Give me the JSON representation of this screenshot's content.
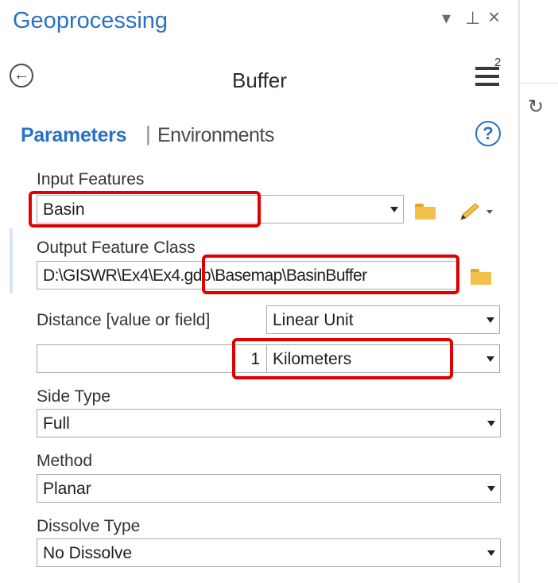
{
  "pane": {
    "title": "Geoprocessing",
    "controls": {
      "dropdown": "▾",
      "pin": "⊥",
      "close": "×"
    },
    "tool_name": "Buffer",
    "menu_badge": "2",
    "tabs": {
      "parameters": "Parameters",
      "separator": "|",
      "environments": "Environments"
    },
    "help": "?"
  },
  "params": {
    "input_features": {
      "label": "Input Features",
      "value": "Basin"
    },
    "output_feature_class": {
      "label": "Output Feature Class",
      "value": "D:\\GISWR\\Ex4\\Ex4.gdb\\Basemap\\BasinBuffer"
    },
    "distance": {
      "label": "Distance [value or field]",
      "type_value": "Linear Unit",
      "number": "1",
      "unit": "Kilometers"
    },
    "side_type": {
      "label": "Side Type",
      "value": "Full"
    },
    "method": {
      "label": "Method",
      "value": "Planar"
    },
    "dissolve_type": {
      "label": "Dissolve Type",
      "value": "No Dissolve"
    }
  },
  "colors": {
    "accent": "#2a72c2",
    "highlight": "#e00000",
    "folder": "#f2c04a"
  },
  "icons": [
    "back-icon",
    "menu-icon",
    "help-icon",
    "folder-icon",
    "pencil-icon",
    "refresh-icon"
  ]
}
